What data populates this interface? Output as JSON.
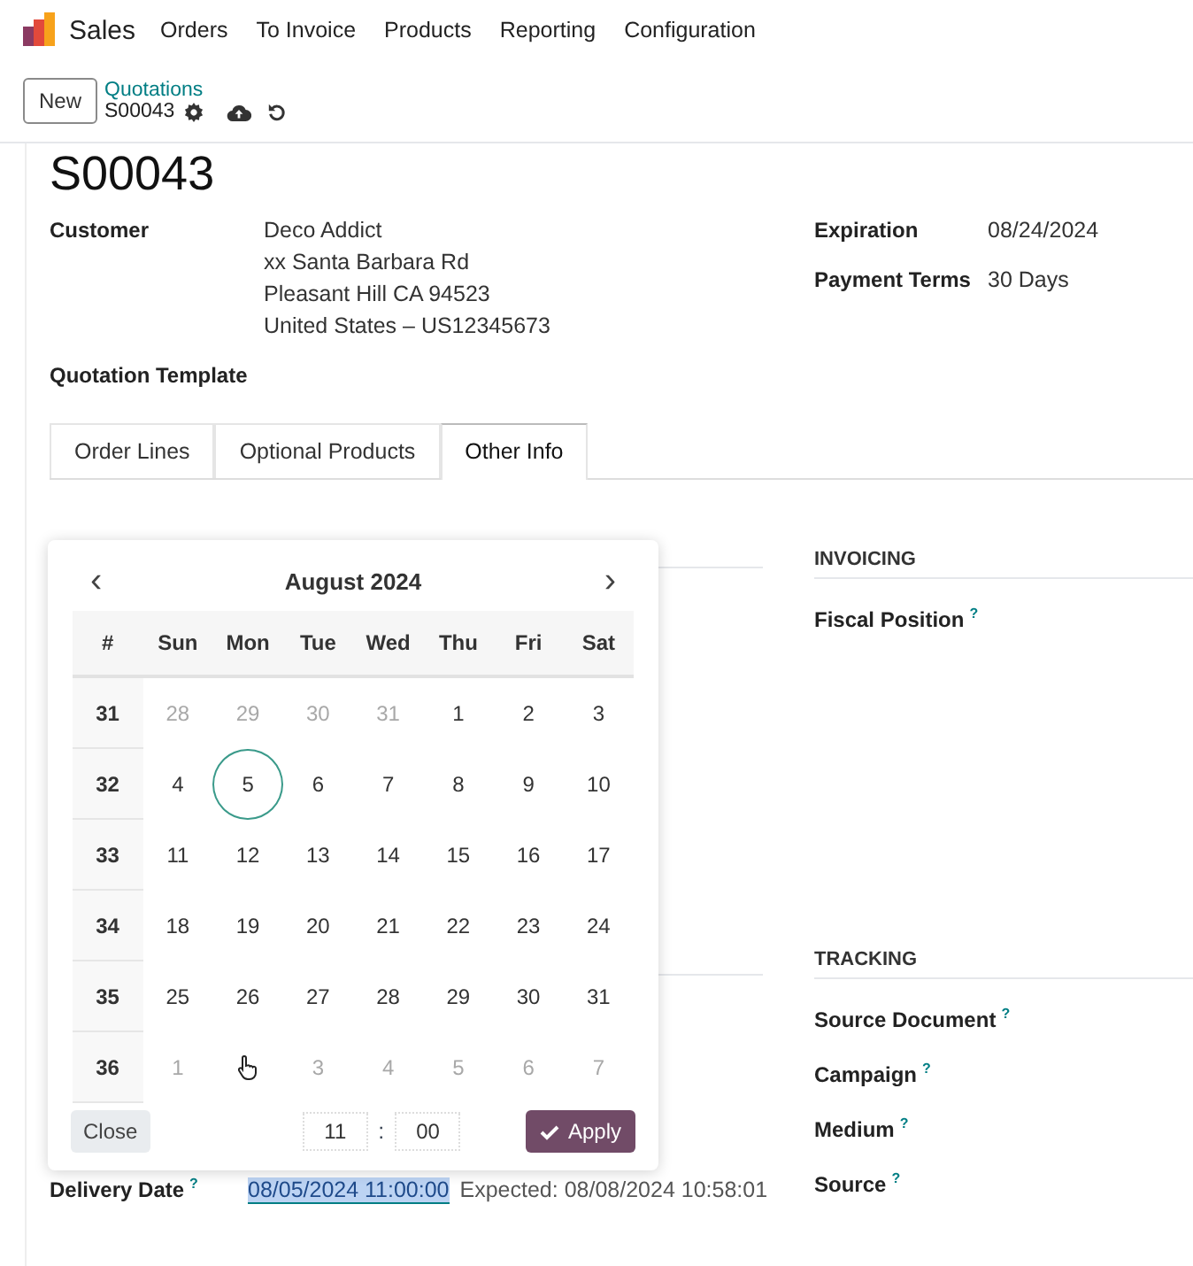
{
  "navbar": {
    "app": "Sales",
    "menu": [
      "Orders",
      "To Invoice",
      "Products",
      "Reporting",
      "Configuration"
    ]
  },
  "control_panel": {
    "new_button": "New",
    "breadcrumb": "Quotations",
    "record": "S00043"
  },
  "form": {
    "title": "S00043",
    "left_fields": [
      {
        "label": "Customer",
        "lines": [
          "Deco Addict",
          "xx Santa Barbara Rd",
          "Pleasant Hill CA 94523",
          "United States – US12345673"
        ]
      },
      {
        "label": "Quotation Template"
      }
    ],
    "right_fields": [
      {
        "label": "Expiration",
        "value": "08/24/2024"
      },
      {
        "label": "Payment Terms",
        "value": "30 Days"
      }
    ],
    "tabs": [
      {
        "label": "Order Lines",
        "selected": false
      },
      {
        "label": "Optional Products",
        "selected": false
      },
      {
        "label": "Other Info",
        "selected": true
      }
    ],
    "delivery": {
      "label": "Delivery Date",
      "help": "?",
      "value": "08/05/2024 11:00:00",
      "expected": "Expected: 08/08/2024 10:58:01"
    },
    "sections": [
      {
        "heading": "INVOICING",
        "fields": [
          {
            "label": "Fiscal Position",
            "help": "?"
          }
        ]
      },
      {
        "heading": "TRACKING",
        "fields": [
          {
            "label": "Source Document",
            "help": "?"
          },
          {
            "label": "Campaign",
            "help": "?"
          },
          {
            "label": "Medium",
            "help": "?"
          },
          {
            "label": "Source",
            "help": "?"
          }
        ]
      }
    ]
  },
  "datepicker": {
    "month": "August 2024",
    "prev": "‹",
    "next": "›",
    "week_header": "#",
    "weekdays": [
      "Sun",
      "Mon",
      "Tue",
      "Wed",
      "Thu",
      "Fri",
      "Sat"
    ],
    "weeks": [
      {
        "week": "31",
        "days": [
          {
            "kind": "day",
            "text": "28",
            "muted": true,
            "selected": false
          },
          {
            "kind": "day",
            "text": "29",
            "muted": true,
            "selected": false
          },
          {
            "kind": "day",
            "text": "30",
            "muted": true,
            "selected": false
          },
          {
            "kind": "day",
            "text": "31",
            "muted": true,
            "selected": false
          },
          {
            "kind": "day",
            "text": "1",
            "muted": false,
            "selected": false
          },
          {
            "kind": "day",
            "text": "2",
            "muted": false,
            "selected": false
          },
          {
            "kind": "day",
            "text": "3",
            "muted": false,
            "selected": false
          }
        ]
      },
      {
        "week": "32",
        "days": [
          {
            "kind": "day",
            "text": "4",
            "muted": false,
            "selected": false
          },
          {
            "kind": "day",
            "text": "5",
            "muted": false,
            "selected": true
          },
          {
            "kind": "day",
            "text": "6",
            "muted": false,
            "selected": false
          },
          {
            "kind": "day",
            "text": "7",
            "muted": false,
            "selected": false
          },
          {
            "kind": "day",
            "text": "8",
            "muted": false,
            "selected": false
          },
          {
            "kind": "day",
            "text": "9",
            "muted": false,
            "selected": false
          },
          {
            "kind": "day",
            "text": "10",
            "muted": false,
            "selected": false
          }
        ]
      },
      {
        "week": "33",
        "days": [
          {
            "kind": "day",
            "text": "11",
            "muted": false,
            "selected": false
          },
          {
            "kind": "day",
            "text": "12",
            "muted": false,
            "selected": false
          },
          {
            "kind": "day",
            "text": "13",
            "muted": false,
            "selected": false
          },
          {
            "kind": "day",
            "text": "14",
            "muted": false,
            "selected": false
          },
          {
            "kind": "day",
            "text": "15",
            "muted": false,
            "selected": false
          },
          {
            "kind": "day",
            "text": "16",
            "muted": false,
            "selected": false
          },
          {
            "kind": "day",
            "text": "17",
            "muted": false,
            "selected": false
          }
        ]
      },
      {
        "week": "34",
        "days": [
          {
            "kind": "day",
            "text": "18",
            "muted": false,
            "selected": false
          },
          {
            "kind": "day",
            "text": "19",
            "muted": false,
            "selected": false
          },
          {
            "kind": "day",
            "text": "20",
            "muted": false,
            "selected": false
          },
          {
            "kind": "day",
            "text": "21",
            "muted": false,
            "selected": false
          },
          {
            "kind": "day",
            "text": "22",
            "muted": false,
            "selected": false
          },
          {
            "kind": "day",
            "text": "23",
            "muted": false,
            "selected": false
          },
          {
            "kind": "day",
            "text": "24",
            "muted": false,
            "selected": false
          }
        ]
      },
      {
        "week": "35",
        "days": [
          {
            "kind": "day",
            "text": "25",
            "muted": false,
            "selected": false
          },
          {
            "kind": "day",
            "text": "26",
            "muted": false,
            "selected": false
          },
          {
            "kind": "day",
            "text": "27",
            "muted": false,
            "selected": false
          },
          {
            "kind": "day",
            "text": "28",
            "muted": false,
            "selected": false
          },
          {
            "kind": "day",
            "text": "29",
            "muted": false,
            "selected": false
          },
          {
            "kind": "day",
            "text": "30",
            "muted": false,
            "selected": false
          },
          {
            "kind": "day",
            "text": "31",
            "muted": false,
            "selected": false
          }
        ]
      },
      {
        "week": "36",
        "days": [
          {
            "kind": "day",
            "text": "1",
            "muted": true,
            "selected": false
          },
          {
            "kind": "cursor"
          },
          {
            "kind": "day",
            "text": "3",
            "muted": true,
            "selected": false
          },
          {
            "kind": "day",
            "text": "4",
            "muted": true,
            "selected": false
          },
          {
            "kind": "day",
            "text": "5",
            "muted": true,
            "selected": false
          },
          {
            "kind": "day",
            "text": "6",
            "muted": true,
            "selected": false
          },
          {
            "kind": "day",
            "text": "7",
            "muted": true,
            "selected": false
          }
        ]
      }
    ],
    "close": "Close",
    "hour": "11",
    "separator": ":",
    "minute": "00",
    "apply": "Apply"
  }
}
